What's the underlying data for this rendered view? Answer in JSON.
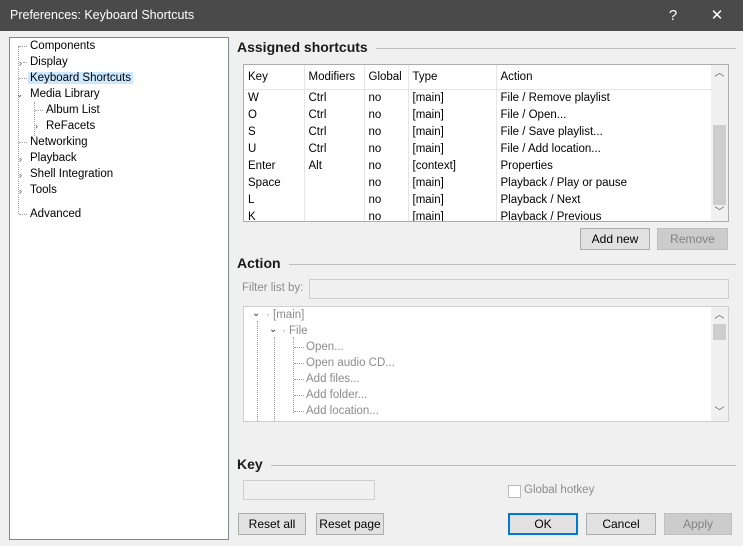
{
  "window": {
    "title": "Preferences: Keyboard Shortcuts",
    "help_glyph": "?",
    "close_glyph": "✕"
  },
  "tree": {
    "components": "Components",
    "display": "Display",
    "keyboard_shortcuts": "Keyboard Shortcuts",
    "media_library": "Media Library",
    "album_list": "Album List",
    "refacets": "ReFacets",
    "networking": "Networking",
    "playback": "Playback",
    "shell_integration": "Shell Integration",
    "tools": "Tools",
    "advanced": "Advanced"
  },
  "assigned": {
    "title": "Assigned shortcuts",
    "columns": [
      "Key",
      "Modifiers",
      "Global",
      "Type",
      "Action"
    ],
    "rows": [
      [
        "W",
        "Ctrl",
        "no",
        "[main]",
        "File / Remove playlist"
      ],
      [
        "O",
        "Ctrl",
        "no",
        "[main]",
        "File / Open..."
      ],
      [
        "S",
        "Ctrl",
        "no",
        "[main]",
        "File / Save playlist..."
      ],
      [
        "U",
        "Ctrl",
        "no",
        "[main]",
        "File / Add location..."
      ],
      [
        "Enter",
        "Alt",
        "no",
        "[context]",
        "Properties"
      ],
      [
        "Space",
        "",
        "no",
        "[main]",
        "Playback / Play or pause"
      ],
      [
        "L",
        "",
        "no",
        "[main]",
        "Playback / Next"
      ],
      [
        "K",
        "",
        "no",
        "[main]",
        "Playback / Previous"
      ]
    ],
    "add_new": "Add new",
    "remove": "Remove"
  },
  "action": {
    "title": "Action",
    "filter_label": "Filter list by:",
    "filter_value": "",
    "tree": {
      "main": "[main]",
      "file": "File",
      "items": [
        "Open...",
        "Open audio CD...",
        "Add files...",
        "Add folder...",
        "Add location..."
      ]
    }
  },
  "key": {
    "title": "Key",
    "value": "",
    "global_hotkey": "Global hotkey",
    "global_hotkey_checked": false
  },
  "buttons": {
    "reset_all": "Reset all",
    "reset_page": "Reset page",
    "ok": "OK",
    "cancel": "Cancel",
    "apply": "Apply"
  }
}
